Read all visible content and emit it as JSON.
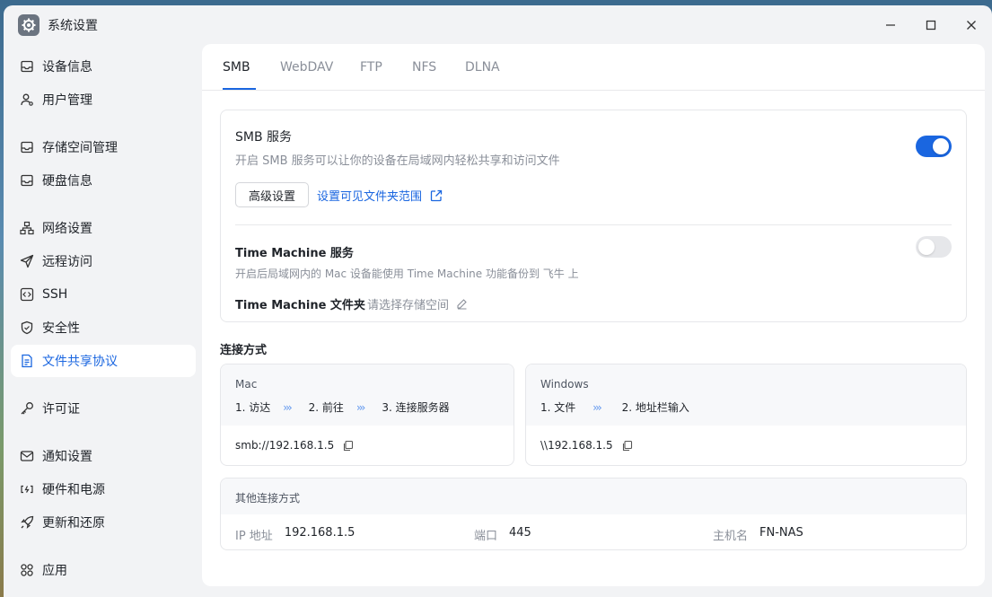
{
  "window": {
    "title": "系统设置"
  },
  "sidebar": {
    "items": [
      {
        "label": "设备信息",
        "icon": "monitor-icon",
        "active": false
      },
      {
        "label": "用户管理",
        "icon": "user-icon",
        "active": false
      },
      {
        "label": "存储空间管理",
        "icon": "storage-icon",
        "active": false
      },
      {
        "label": "硬盘信息",
        "icon": "disk-icon",
        "active": false
      },
      {
        "label": "网络设置",
        "icon": "network-icon",
        "active": false
      },
      {
        "label": "远程访问",
        "icon": "send-icon",
        "active": false
      },
      {
        "label": "SSH",
        "icon": "code-icon",
        "active": false
      },
      {
        "label": "安全性",
        "icon": "shield-icon",
        "active": false
      },
      {
        "label": "文件共享协议",
        "icon": "document-icon",
        "active": true
      },
      {
        "label": "许可证",
        "icon": "key-icon",
        "active": false
      },
      {
        "label": "通知设置",
        "icon": "mail-icon",
        "active": false
      },
      {
        "label": "硬件和电源",
        "icon": "battery-icon",
        "active": false
      },
      {
        "label": "更新和还原",
        "icon": "rocket-icon",
        "active": false
      },
      {
        "label": "应用",
        "icon": "apps-icon",
        "active": false
      }
    ]
  },
  "tabs": [
    "SMB",
    "WebDAV",
    "FTP",
    "NFS",
    "DLNA"
  ],
  "smb": {
    "title": "SMB 服务",
    "desc": "开启 SMB 服务可以让你的设备在局域网内轻松共享和访问文件",
    "enabled": true,
    "advanced_button": "高级设置",
    "folder_link": "设置可见文件夹范围"
  },
  "time_machine": {
    "title": "Time Machine 服务",
    "desc": "开启后局域网内的 Mac 设备能使用 Time Machine 功能备份到 飞牛 上",
    "enabled": false,
    "folder_label": "Time Machine 文件夹",
    "folder_placeholder": "请选择存储空间"
  },
  "connection": {
    "title": "连接方式",
    "mac": {
      "os": "Mac",
      "steps": [
        "1. 访达",
        "2. 前往",
        "3. 连接服务器"
      ],
      "address": "smb://192.168.1.5"
    },
    "windows": {
      "os": "Windows",
      "steps": [
        "1. 文件",
        "2. 地址栏输入"
      ],
      "address": "\\\\192.168.1.5"
    },
    "arrow": "›››"
  },
  "other": {
    "title": "其他连接方式",
    "ip_label": "IP 地址",
    "ip_value": "192.168.1.5",
    "port_label": "端口",
    "port_value": "445",
    "host_label": "主机名",
    "host_value": "FN-NAS"
  },
  "colors": {
    "accent": "#1a66e0",
    "muted_text": "#8a8f99",
    "toggle_off": "#e6e7ea"
  }
}
